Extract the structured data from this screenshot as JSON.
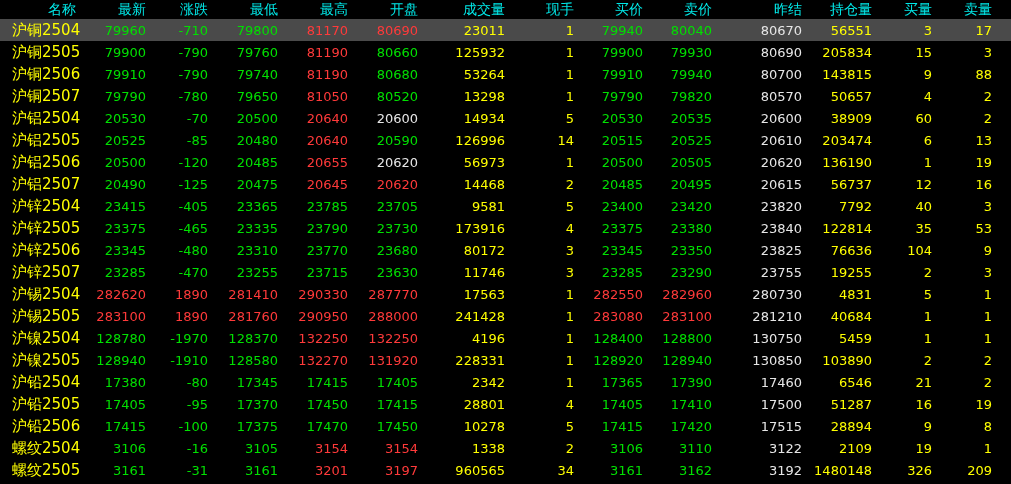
{
  "table": {
    "name_header": "名称",
    "columns": [
      "最新",
      "涨跌",
      "最低",
      "最高",
      "开盘",
      "成交量",
      "现手",
      "买价",
      "卖价",
      "昨结",
      "持仓量",
      "买量",
      "卖量"
    ],
    "rows": [
      {
        "name": "沪铜2504",
        "selected": true,
        "cells": [
          {
            "text": "79960",
            "color": "#00e000"
          },
          {
            "text": "-710",
            "color": "#00e000"
          },
          {
            "text": "79800",
            "color": "#00e000"
          },
          {
            "text": "81170",
            "color": "#ff3a3a"
          },
          {
            "text": "80690",
            "color": "#ff3a3a"
          },
          {
            "text": "23011",
            "color": "#ffff00"
          },
          {
            "text": "1",
            "color": "#ffff00"
          },
          {
            "text": "79940",
            "color": "#00e000"
          },
          {
            "text": "80040",
            "color": "#00e000"
          },
          {
            "text": "80670",
            "color": "#e6e6e6"
          },
          {
            "text": "56551",
            "color": "#ffff00"
          },
          {
            "text": "3",
            "color": "#ffff00"
          },
          {
            "text": "17",
            "color": "#ffff00"
          }
        ]
      },
      {
        "name": "沪铜2505",
        "selected": false,
        "cells": [
          {
            "text": "79900",
            "color": "#00e000"
          },
          {
            "text": "-790",
            "color": "#00e000"
          },
          {
            "text": "79760",
            "color": "#00e000"
          },
          {
            "text": "81190",
            "color": "#ff3a3a"
          },
          {
            "text": "80660",
            "color": "#00e000"
          },
          {
            "text": "125932",
            "color": "#ffff00"
          },
          {
            "text": "1",
            "color": "#ffff00"
          },
          {
            "text": "79900",
            "color": "#00e000"
          },
          {
            "text": "79930",
            "color": "#00e000"
          },
          {
            "text": "80690",
            "color": "#e6e6e6"
          },
          {
            "text": "205834",
            "color": "#ffff00"
          },
          {
            "text": "15",
            "color": "#ffff00"
          },
          {
            "text": "3",
            "color": "#ffff00"
          }
        ]
      },
      {
        "name": "沪铜2506",
        "selected": false,
        "cells": [
          {
            "text": "79910",
            "color": "#00e000"
          },
          {
            "text": "-790",
            "color": "#00e000"
          },
          {
            "text": "79740",
            "color": "#00e000"
          },
          {
            "text": "81190",
            "color": "#ff3a3a"
          },
          {
            "text": "80680",
            "color": "#00e000"
          },
          {
            "text": "53264",
            "color": "#ffff00"
          },
          {
            "text": "1",
            "color": "#ffff00"
          },
          {
            "text": "79910",
            "color": "#00e000"
          },
          {
            "text": "79940",
            "color": "#00e000"
          },
          {
            "text": "80700",
            "color": "#e6e6e6"
          },
          {
            "text": "143815",
            "color": "#ffff00"
          },
          {
            "text": "9",
            "color": "#ffff00"
          },
          {
            "text": "88",
            "color": "#ffff00"
          }
        ]
      },
      {
        "name": "沪铜2507",
        "selected": false,
        "cells": [
          {
            "text": "79790",
            "color": "#00e000"
          },
          {
            "text": "-780",
            "color": "#00e000"
          },
          {
            "text": "79650",
            "color": "#00e000"
          },
          {
            "text": "81050",
            "color": "#ff3a3a"
          },
          {
            "text": "80520",
            "color": "#00e000"
          },
          {
            "text": "13298",
            "color": "#ffff00"
          },
          {
            "text": "1",
            "color": "#ffff00"
          },
          {
            "text": "79790",
            "color": "#00e000"
          },
          {
            "text": "79820",
            "color": "#00e000"
          },
          {
            "text": "80570",
            "color": "#e6e6e6"
          },
          {
            "text": "50657",
            "color": "#ffff00"
          },
          {
            "text": "4",
            "color": "#ffff00"
          },
          {
            "text": "2",
            "color": "#ffff00"
          }
        ]
      },
      {
        "name": "沪铝2504",
        "selected": false,
        "cells": [
          {
            "text": "20530",
            "color": "#00e000"
          },
          {
            "text": "-70",
            "color": "#00e000"
          },
          {
            "text": "20500",
            "color": "#00e000"
          },
          {
            "text": "20640",
            "color": "#ff3a3a"
          },
          {
            "text": "20600",
            "color": "#e6e6e6"
          },
          {
            "text": "14934",
            "color": "#ffff00"
          },
          {
            "text": "5",
            "color": "#ffff00"
          },
          {
            "text": "20530",
            "color": "#00e000"
          },
          {
            "text": "20535",
            "color": "#00e000"
          },
          {
            "text": "20600",
            "color": "#e6e6e6"
          },
          {
            "text": "38909",
            "color": "#ffff00"
          },
          {
            "text": "60",
            "color": "#ffff00"
          },
          {
            "text": "2",
            "color": "#ffff00"
          }
        ]
      },
      {
        "name": "沪铝2505",
        "selected": false,
        "cells": [
          {
            "text": "20525",
            "color": "#00e000"
          },
          {
            "text": "-85",
            "color": "#00e000"
          },
          {
            "text": "20480",
            "color": "#00e000"
          },
          {
            "text": "20640",
            "color": "#ff3a3a"
          },
          {
            "text": "20590",
            "color": "#00e000"
          },
          {
            "text": "126996",
            "color": "#ffff00"
          },
          {
            "text": "14",
            "color": "#ffff00"
          },
          {
            "text": "20515",
            "color": "#00e000"
          },
          {
            "text": "20525",
            "color": "#00e000"
          },
          {
            "text": "20610",
            "color": "#e6e6e6"
          },
          {
            "text": "203474",
            "color": "#ffff00"
          },
          {
            "text": "6",
            "color": "#ffff00"
          },
          {
            "text": "13",
            "color": "#ffff00"
          }
        ]
      },
      {
        "name": "沪铝2506",
        "selected": false,
        "cells": [
          {
            "text": "20500",
            "color": "#00e000"
          },
          {
            "text": "-120",
            "color": "#00e000"
          },
          {
            "text": "20485",
            "color": "#00e000"
          },
          {
            "text": "20655",
            "color": "#ff3a3a"
          },
          {
            "text": "20620",
            "color": "#e6e6e6"
          },
          {
            "text": "56973",
            "color": "#ffff00"
          },
          {
            "text": "1",
            "color": "#ffff00"
          },
          {
            "text": "20500",
            "color": "#00e000"
          },
          {
            "text": "20505",
            "color": "#00e000"
          },
          {
            "text": "20620",
            "color": "#e6e6e6"
          },
          {
            "text": "136190",
            "color": "#ffff00"
          },
          {
            "text": "1",
            "color": "#ffff00"
          },
          {
            "text": "19",
            "color": "#ffff00"
          }
        ]
      },
      {
        "name": "沪铝2507",
        "selected": false,
        "cells": [
          {
            "text": "20490",
            "color": "#00e000"
          },
          {
            "text": "-125",
            "color": "#00e000"
          },
          {
            "text": "20475",
            "color": "#00e000"
          },
          {
            "text": "20645",
            "color": "#ff3a3a"
          },
          {
            "text": "20620",
            "color": "#ff3a3a"
          },
          {
            "text": "14468",
            "color": "#ffff00"
          },
          {
            "text": "2",
            "color": "#ffff00"
          },
          {
            "text": "20485",
            "color": "#00e000"
          },
          {
            "text": "20495",
            "color": "#00e000"
          },
          {
            "text": "20615",
            "color": "#e6e6e6"
          },
          {
            "text": "56737",
            "color": "#ffff00"
          },
          {
            "text": "12",
            "color": "#ffff00"
          },
          {
            "text": "16",
            "color": "#ffff00"
          }
        ]
      },
      {
        "name": "沪锌2504",
        "selected": false,
        "cells": [
          {
            "text": "23415",
            "color": "#00e000"
          },
          {
            "text": "-405",
            "color": "#00e000"
          },
          {
            "text": "23365",
            "color": "#00e000"
          },
          {
            "text": "23785",
            "color": "#00e000"
          },
          {
            "text": "23705",
            "color": "#00e000"
          },
          {
            "text": "9581",
            "color": "#ffff00"
          },
          {
            "text": "5",
            "color": "#ffff00"
          },
          {
            "text": "23400",
            "color": "#00e000"
          },
          {
            "text": "23420",
            "color": "#00e000"
          },
          {
            "text": "23820",
            "color": "#e6e6e6"
          },
          {
            "text": "7792",
            "color": "#ffff00"
          },
          {
            "text": "40",
            "color": "#ffff00"
          },
          {
            "text": "3",
            "color": "#ffff00"
          }
        ]
      },
      {
        "name": "沪锌2505",
        "selected": false,
        "cells": [
          {
            "text": "23375",
            "color": "#00e000"
          },
          {
            "text": "-465",
            "color": "#00e000"
          },
          {
            "text": "23335",
            "color": "#00e000"
          },
          {
            "text": "23790",
            "color": "#00e000"
          },
          {
            "text": "23730",
            "color": "#00e000"
          },
          {
            "text": "173916",
            "color": "#ffff00"
          },
          {
            "text": "4",
            "color": "#ffff00"
          },
          {
            "text": "23375",
            "color": "#00e000"
          },
          {
            "text": "23380",
            "color": "#00e000"
          },
          {
            "text": "23840",
            "color": "#e6e6e6"
          },
          {
            "text": "122814",
            "color": "#ffff00"
          },
          {
            "text": "35",
            "color": "#ffff00"
          },
          {
            "text": "53",
            "color": "#ffff00"
          }
        ]
      },
      {
        "name": "沪锌2506",
        "selected": false,
        "cells": [
          {
            "text": "23345",
            "color": "#00e000"
          },
          {
            "text": "-480",
            "color": "#00e000"
          },
          {
            "text": "23310",
            "color": "#00e000"
          },
          {
            "text": "23770",
            "color": "#00e000"
          },
          {
            "text": "23680",
            "color": "#00e000"
          },
          {
            "text": "80172",
            "color": "#ffff00"
          },
          {
            "text": "3",
            "color": "#ffff00"
          },
          {
            "text": "23345",
            "color": "#00e000"
          },
          {
            "text": "23350",
            "color": "#00e000"
          },
          {
            "text": "23825",
            "color": "#e6e6e6"
          },
          {
            "text": "76636",
            "color": "#ffff00"
          },
          {
            "text": "104",
            "color": "#ffff00"
          },
          {
            "text": "9",
            "color": "#ffff00"
          }
        ]
      },
      {
        "name": "沪锌2507",
        "selected": false,
        "cells": [
          {
            "text": "23285",
            "color": "#00e000"
          },
          {
            "text": "-470",
            "color": "#00e000"
          },
          {
            "text": "23255",
            "color": "#00e000"
          },
          {
            "text": "23715",
            "color": "#00e000"
          },
          {
            "text": "23630",
            "color": "#00e000"
          },
          {
            "text": "11746",
            "color": "#ffff00"
          },
          {
            "text": "3",
            "color": "#ffff00"
          },
          {
            "text": "23285",
            "color": "#00e000"
          },
          {
            "text": "23290",
            "color": "#00e000"
          },
          {
            "text": "23755",
            "color": "#e6e6e6"
          },
          {
            "text": "19255",
            "color": "#ffff00"
          },
          {
            "text": "2",
            "color": "#ffff00"
          },
          {
            "text": "3",
            "color": "#ffff00"
          }
        ]
      },
      {
        "name": "沪锡2504",
        "selected": false,
        "cells": [
          {
            "text": "282620",
            "color": "#ff3a3a"
          },
          {
            "text": "1890",
            "color": "#ff3a3a"
          },
          {
            "text": "281410",
            "color": "#ff3a3a"
          },
          {
            "text": "290330",
            "color": "#ff3a3a"
          },
          {
            "text": "287770",
            "color": "#ff3a3a"
          },
          {
            "text": "17563",
            "color": "#ffff00"
          },
          {
            "text": "1",
            "color": "#ffff00"
          },
          {
            "text": "282550",
            "color": "#ff3a3a"
          },
          {
            "text": "282960",
            "color": "#ff3a3a"
          },
          {
            "text": "280730",
            "color": "#e6e6e6"
          },
          {
            "text": "4831",
            "color": "#ffff00"
          },
          {
            "text": "5",
            "color": "#ffff00"
          },
          {
            "text": "1",
            "color": "#ffff00"
          }
        ]
      },
      {
        "name": "沪锡2505",
        "selected": false,
        "cells": [
          {
            "text": "283100",
            "color": "#ff3a3a"
          },
          {
            "text": "1890",
            "color": "#ff3a3a"
          },
          {
            "text": "281760",
            "color": "#ff3a3a"
          },
          {
            "text": "290950",
            "color": "#ff3a3a"
          },
          {
            "text": "288000",
            "color": "#ff3a3a"
          },
          {
            "text": "241428",
            "color": "#ffff00"
          },
          {
            "text": "1",
            "color": "#ffff00"
          },
          {
            "text": "283080",
            "color": "#ff3a3a"
          },
          {
            "text": "283100",
            "color": "#ff3a3a"
          },
          {
            "text": "281210",
            "color": "#e6e6e6"
          },
          {
            "text": "40684",
            "color": "#ffff00"
          },
          {
            "text": "1",
            "color": "#ffff00"
          },
          {
            "text": "1",
            "color": "#ffff00"
          }
        ]
      },
      {
        "name": "沪镍2504",
        "selected": false,
        "cells": [
          {
            "text": "128780",
            "color": "#00e000"
          },
          {
            "text": "-1970",
            "color": "#00e000"
          },
          {
            "text": "128370",
            "color": "#00e000"
          },
          {
            "text": "132250",
            "color": "#ff3a3a"
          },
          {
            "text": "132250",
            "color": "#ff3a3a"
          },
          {
            "text": "4196",
            "color": "#ffff00"
          },
          {
            "text": "1",
            "color": "#ffff00"
          },
          {
            "text": "128400",
            "color": "#00e000"
          },
          {
            "text": "128800",
            "color": "#00e000"
          },
          {
            "text": "130750",
            "color": "#e6e6e6"
          },
          {
            "text": "5459",
            "color": "#ffff00"
          },
          {
            "text": "1",
            "color": "#ffff00"
          },
          {
            "text": "1",
            "color": "#ffff00"
          }
        ]
      },
      {
        "name": "沪镍2505",
        "selected": false,
        "cells": [
          {
            "text": "128940",
            "color": "#00e000"
          },
          {
            "text": "-1910",
            "color": "#00e000"
          },
          {
            "text": "128580",
            "color": "#00e000"
          },
          {
            "text": "132270",
            "color": "#ff3a3a"
          },
          {
            "text": "131920",
            "color": "#ff3a3a"
          },
          {
            "text": "228331",
            "color": "#ffff00"
          },
          {
            "text": "1",
            "color": "#ffff00"
          },
          {
            "text": "128920",
            "color": "#00e000"
          },
          {
            "text": "128940",
            "color": "#00e000"
          },
          {
            "text": "130850",
            "color": "#e6e6e6"
          },
          {
            "text": "103890",
            "color": "#ffff00"
          },
          {
            "text": "2",
            "color": "#ffff00"
          },
          {
            "text": "2",
            "color": "#ffff00"
          }
        ]
      },
      {
        "name": "沪铅2504",
        "selected": false,
        "cells": [
          {
            "text": "17380",
            "color": "#00e000"
          },
          {
            "text": "-80",
            "color": "#00e000"
          },
          {
            "text": "17345",
            "color": "#00e000"
          },
          {
            "text": "17415",
            "color": "#00e000"
          },
          {
            "text": "17405",
            "color": "#00e000"
          },
          {
            "text": "2342",
            "color": "#ffff00"
          },
          {
            "text": "1",
            "color": "#ffff00"
          },
          {
            "text": "17365",
            "color": "#00e000"
          },
          {
            "text": "17390",
            "color": "#00e000"
          },
          {
            "text": "17460",
            "color": "#e6e6e6"
          },
          {
            "text": "6546",
            "color": "#ffff00"
          },
          {
            "text": "21",
            "color": "#ffff00"
          },
          {
            "text": "2",
            "color": "#ffff00"
          }
        ]
      },
      {
        "name": "沪铅2505",
        "selected": false,
        "cells": [
          {
            "text": "17405",
            "color": "#00e000"
          },
          {
            "text": "-95",
            "color": "#00e000"
          },
          {
            "text": "17370",
            "color": "#00e000"
          },
          {
            "text": "17450",
            "color": "#00e000"
          },
          {
            "text": "17415",
            "color": "#00e000"
          },
          {
            "text": "28801",
            "color": "#ffff00"
          },
          {
            "text": "4",
            "color": "#ffff00"
          },
          {
            "text": "17405",
            "color": "#00e000"
          },
          {
            "text": "17410",
            "color": "#00e000"
          },
          {
            "text": "17500",
            "color": "#e6e6e6"
          },
          {
            "text": "51287",
            "color": "#ffff00"
          },
          {
            "text": "16",
            "color": "#ffff00"
          },
          {
            "text": "19",
            "color": "#ffff00"
          }
        ]
      },
      {
        "name": "沪铅2506",
        "selected": false,
        "cells": [
          {
            "text": "17415",
            "color": "#00e000"
          },
          {
            "text": "-100",
            "color": "#00e000"
          },
          {
            "text": "17375",
            "color": "#00e000"
          },
          {
            "text": "17470",
            "color": "#00e000"
          },
          {
            "text": "17450",
            "color": "#00e000"
          },
          {
            "text": "10278",
            "color": "#ffff00"
          },
          {
            "text": "5",
            "color": "#ffff00"
          },
          {
            "text": "17415",
            "color": "#00e000"
          },
          {
            "text": "17420",
            "color": "#00e000"
          },
          {
            "text": "17515",
            "color": "#e6e6e6"
          },
          {
            "text": "28894",
            "color": "#ffff00"
          },
          {
            "text": "9",
            "color": "#ffff00"
          },
          {
            "text": "8",
            "color": "#ffff00"
          }
        ]
      },
      {
        "name": "螺纹2504",
        "selected": false,
        "cells": [
          {
            "text": "3106",
            "color": "#00e000"
          },
          {
            "text": "-16",
            "color": "#00e000"
          },
          {
            "text": "3105",
            "color": "#00e000"
          },
          {
            "text": "3154",
            "color": "#ff3a3a"
          },
          {
            "text": "3154",
            "color": "#ff3a3a"
          },
          {
            "text": "1338",
            "color": "#ffff00"
          },
          {
            "text": "2",
            "color": "#ffff00"
          },
          {
            "text": "3106",
            "color": "#00e000"
          },
          {
            "text": "3110",
            "color": "#00e000"
          },
          {
            "text": "3122",
            "color": "#e6e6e6"
          },
          {
            "text": "2109",
            "color": "#ffff00"
          },
          {
            "text": "19",
            "color": "#ffff00"
          },
          {
            "text": "1",
            "color": "#ffff00"
          }
        ]
      },
      {
        "name": "螺纹2505",
        "selected": false,
        "cells": [
          {
            "text": "3161",
            "color": "#00e000"
          },
          {
            "text": "-31",
            "color": "#00e000"
          },
          {
            "text": "3161",
            "color": "#00e000"
          },
          {
            "text": "3201",
            "color": "#ff3a3a"
          },
          {
            "text": "3197",
            "color": "#ff3a3a"
          },
          {
            "text": "960565",
            "color": "#ffff00"
          },
          {
            "text": "34",
            "color": "#ffff00"
          },
          {
            "text": "3161",
            "color": "#00e000"
          },
          {
            "text": "3162",
            "color": "#00e000"
          },
          {
            "text": "3192",
            "color": "#e6e6e6"
          },
          {
            "text": "1480148",
            "color": "#ffff00"
          },
          {
            "text": "326",
            "color": "#ffff00"
          },
          {
            "text": "209",
            "color": "#ffff00"
          }
        ]
      }
    ]
  }
}
